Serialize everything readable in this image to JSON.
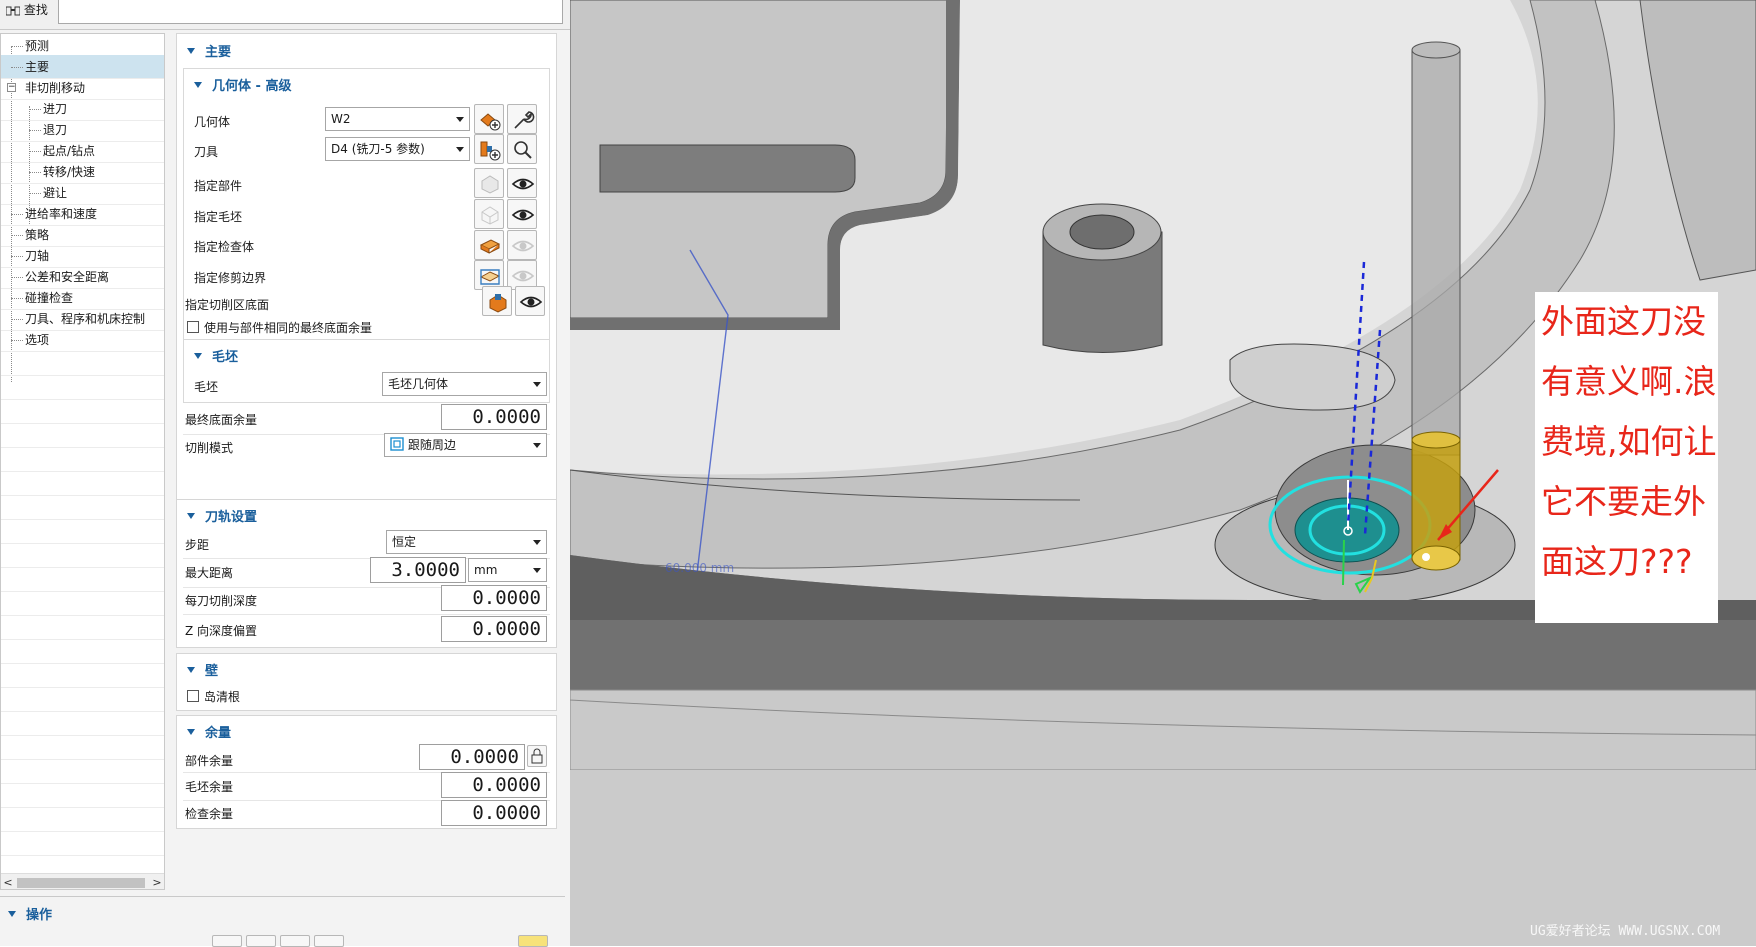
{
  "toolbar": {
    "search_label": "查找"
  },
  "tree": {
    "items": [
      {
        "label": "预测",
        "level": 0,
        "selected": false
      },
      {
        "label": "主要",
        "level": 0,
        "selected": true
      },
      {
        "label": "非切削移动",
        "level": 0,
        "selected": false,
        "expanded": true
      },
      {
        "label": "进刀",
        "level": 1,
        "selected": false
      },
      {
        "label": "退刀",
        "level": 1,
        "selected": false
      },
      {
        "label": "起点/钻点",
        "level": 1,
        "selected": false
      },
      {
        "label": "转移/快速",
        "level": 1,
        "selected": false
      },
      {
        "label": "避让",
        "level": 1,
        "selected": false
      },
      {
        "label": "进给率和速度",
        "level": 0,
        "selected": false
      },
      {
        "label": "策略",
        "level": 0,
        "selected": false
      },
      {
        "label": "刀轴",
        "level": 0,
        "selected": false
      },
      {
        "label": "公差和安全距离",
        "level": 0,
        "selected": false
      },
      {
        "label": "碰撞检查",
        "level": 0,
        "selected": false
      },
      {
        "label": "刀具、程序和机床控制",
        "level": 0,
        "selected": false
      },
      {
        "label": "选项",
        "level": 0,
        "selected": false
      }
    ]
  },
  "main": {
    "title": "主要",
    "geometry": {
      "title": "几何体 - 高级",
      "geometry_label": "几何体",
      "geometry_value": "W2",
      "tool_label": "刀具",
      "tool_value": "D4 (铣刀-5 参数)",
      "part_label": "指定部件",
      "blank_label": "指定毛坯",
      "check_label": "指定检查体",
      "trim_label": "指定修剪边界"
    },
    "floor_label": "指定切削区底面",
    "same_stock_label": "使用与部件相同的最终底面余量",
    "stock": {
      "title": "毛坯",
      "blank_label": "毛坯",
      "blank_value": "毛坯几何体"
    },
    "final_floor_label": "最终底面余量",
    "final_floor_value": "0.0000",
    "cut_pattern_label": "切削模式",
    "cut_pattern_value": "跟随周边"
  },
  "path": {
    "title": "刀轨设置",
    "stepover_label": "步距",
    "stepover_value": "恒定",
    "max_dist_label": "最大距离",
    "max_dist_value": "3.0000",
    "max_dist_unit": "mm",
    "depth_label": "每刀切削深度",
    "depth_value": "0.0000",
    "zoffset_label": "Z 向深度偏置",
    "zoffset_value": "0.0000"
  },
  "wall": {
    "title": "壁",
    "island_label": "岛清根"
  },
  "stock_allow": {
    "title": "余量",
    "part_label": "部件余量",
    "part_value": "0.0000",
    "blank_label": "毛坯余量",
    "blank_value": "0.0000",
    "check_label": "检查余量",
    "check_value": "0.0000"
  },
  "operations": {
    "title": "操作"
  },
  "viewport": {
    "annotation_lines": [
      "外面这刀没",
      "有意义啊.浪",
      "费境,如何让",
      "它不要走外",
      "面这刀???"
    ],
    "watermark": "UG爱好者论坛 WWW.UGSNX.COM",
    "dim_label": "60.000 mm",
    "annotation_color": "#e8261a"
  }
}
